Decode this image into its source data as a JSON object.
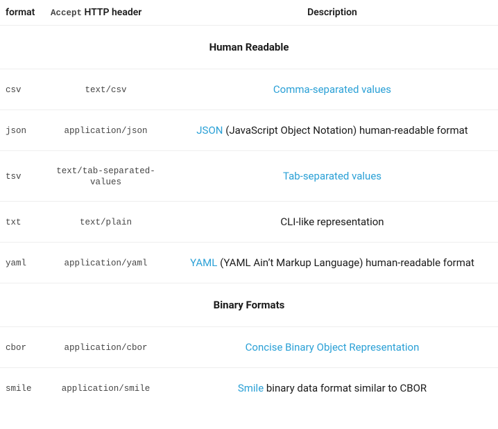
{
  "headers": {
    "format": "format",
    "accept_code": "Accept",
    "accept_suffix": " HTTP header",
    "description": "Description"
  },
  "sections": {
    "human": "Human Readable",
    "binary": "Binary Formats"
  },
  "rows": {
    "csv": {
      "format": "csv",
      "accept": "text/csv",
      "link": "Comma-separated values",
      "suffix": ""
    },
    "json": {
      "format": "json",
      "accept": "application/json",
      "link": "JSON",
      "suffix": " (JavaScript Object Notation) human-readable format"
    },
    "tsv": {
      "format": "tsv",
      "accept": "text/tab-separated-values",
      "link": "Tab-separated values",
      "suffix": ""
    },
    "txt": {
      "format": "txt",
      "accept": "text/plain",
      "link": "",
      "suffix": "CLI-like representation"
    },
    "yaml": {
      "format": "yaml",
      "accept": "application/yaml",
      "link": "YAML",
      "suffix": " (YAML Ain’t Markup Language) human-readable format"
    },
    "cbor": {
      "format": "cbor",
      "accept": "application/cbor",
      "link": "Concise Binary Object Representation",
      "suffix": ""
    },
    "smile": {
      "format": "smile",
      "accept": "application/smile",
      "link": "Smile",
      "suffix": " binary data format similar to CBOR"
    }
  }
}
